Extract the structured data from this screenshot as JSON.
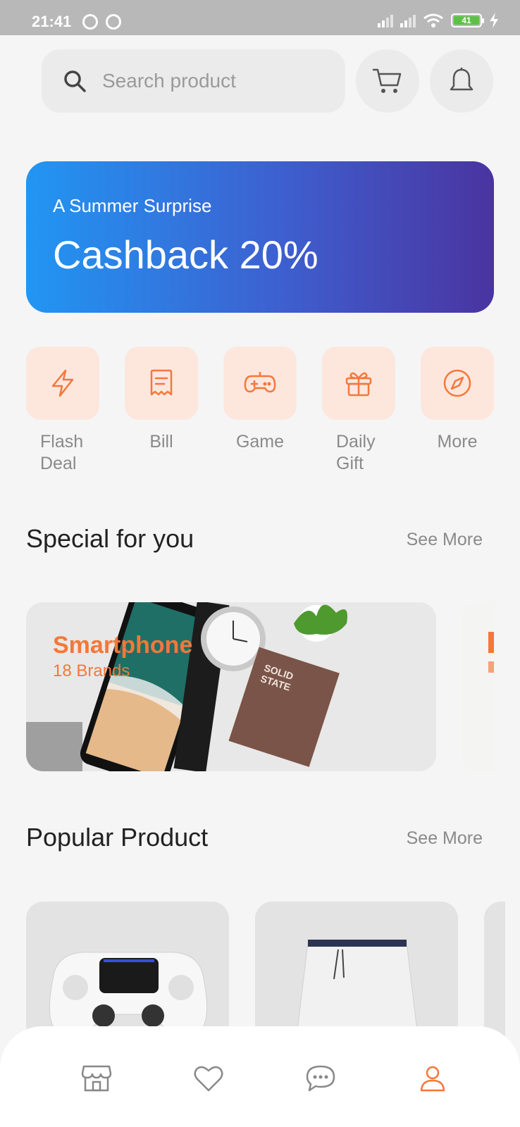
{
  "status_bar": {
    "time": "21:41",
    "battery": "41"
  },
  "header": {
    "search_placeholder": "Search product",
    "cart_icon": "cart-icon",
    "bell_icon": "bell-icon"
  },
  "promo": {
    "subtitle": "A Summer Surprise",
    "title": "Cashback 20%",
    "gradient_start": "#2196f3",
    "gradient_end": "#4a34a0"
  },
  "categories": [
    {
      "label": "Flash Deal",
      "icon": "flash-icon"
    },
    {
      "label": "Bill",
      "icon": "bill-icon"
    },
    {
      "label": "Game",
      "icon": "game-controller-icon"
    },
    {
      "label": "Daily Gift",
      "icon": "gift-icon"
    },
    {
      "label": "More",
      "icon": "compass-icon"
    }
  ],
  "special": {
    "heading": "Special for you",
    "see_more": "See More",
    "cards": [
      {
        "title": "Smartphone",
        "subtitle": "18 Brands"
      }
    ]
  },
  "popular": {
    "heading": "Popular Product",
    "see_more": "See More"
  },
  "bottom_nav": {
    "items": [
      "shop-icon",
      "heart-icon",
      "chat-icon",
      "user-icon"
    ],
    "active": "user-icon"
  },
  "colors": {
    "accent": "#f5773a",
    "category_tile": "#fde7dd",
    "background": "#f5f5f5"
  }
}
